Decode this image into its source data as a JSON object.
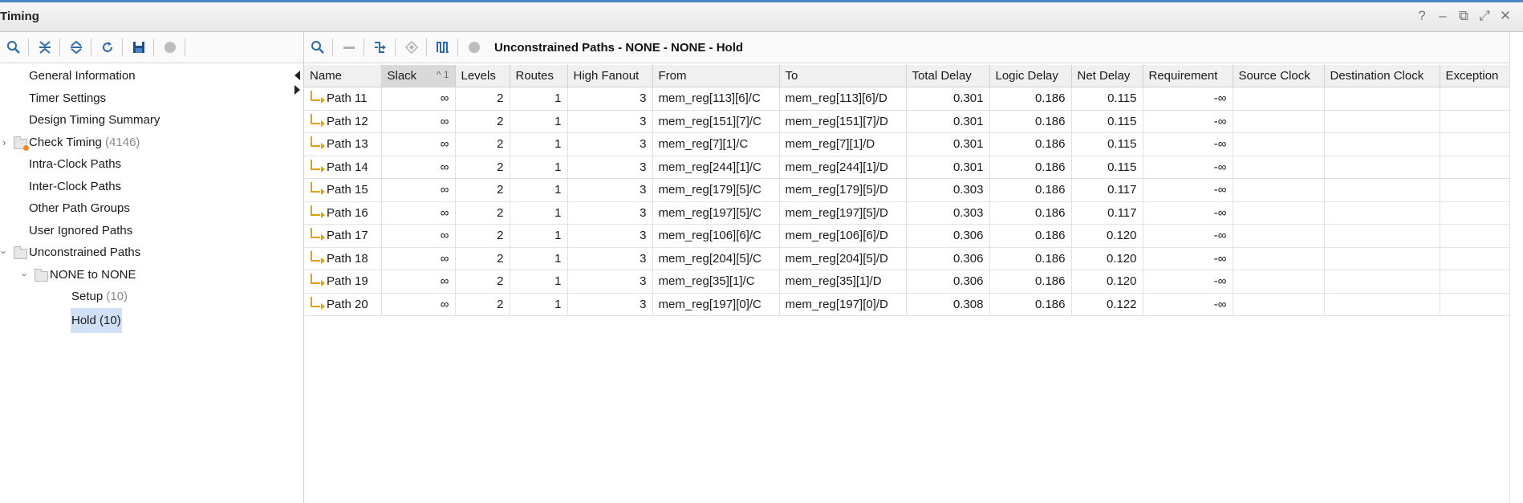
{
  "window": {
    "title": "Timing",
    "controls": [
      "?",
      "–",
      "⧉",
      "⤢",
      "✕"
    ]
  },
  "left_toolbar": {
    "icons": [
      "search-icon",
      "collapse-all-icon",
      "expand-all-icon",
      "refresh-icon",
      "save-icon",
      "stop-icon"
    ]
  },
  "tree": {
    "items": [
      {
        "label": "General Information",
        "count": "",
        "indent": 0
      },
      {
        "label": "Timer Settings",
        "count": "",
        "indent": 0
      },
      {
        "label": "Design Timing Summary",
        "count": "",
        "indent": 0
      },
      {
        "label": "Check Timing",
        "count": "(4146)",
        "indent": 0
      },
      {
        "label": "Intra-Clock Paths",
        "count": "",
        "indent": 0
      },
      {
        "label": "Inter-Clock Paths",
        "count": "",
        "indent": 0
      },
      {
        "label": "Other Path Groups",
        "count": "",
        "indent": 0
      },
      {
        "label": "User Ignored Paths",
        "count": "",
        "indent": 0
      },
      {
        "label": "Unconstrained Paths",
        "count": "",
        "indent": 0
      },
      {
        "label": "NONE to NONE",
        "count": "",
        "indent": 1
      },
      {
        "label": "Setup",
        "count": "(10)",
        "indent": 2
      },
      {
        "label": "Hold (10)",
        "count": "",
        "indent": 2
      }
    ]
  },
  "right_toolbar": {
    "icons": [
      "search-icon",
      "minus-icon",
      "schematic-icon",
      "diamond-icon",
      "waveform-icon",
      "stop-icon"
    ],
    "title": "Unconstrained Paths - NONE - NONE - Hold"
  },
  "table": {
    "columns": [
      "Name",
      "Slack",
      "Levels",
      "Routes",
      "High Fanout",
      "From",
      "To",
      "Total Delay",
      "Logic Delay",
      "Net Delay",
      "Requirement",
      "Source Clock",
      "Destination Clock",
      "Exception"
    ],
    "sort_mark": "^ 1",
    "rows": [
      [
        "Path 11",
        "∞",
        "2",
        "1",
        "3",
        "mem_reg[113][6]/C",
        "mem_reg[113][6]/D",
        "0.301",
        "0.186",
        "0.115",
        "-∞",
        "",
        "",
        ""
      ],
      [
        "Path 12",
        "∞",
        "2",
        "1",
        "3",
        "mem_reg[151][7]/C",
        "mem_reg[151][7]/D",
        "0.301",
        "0.186",
        "0.115",
        "-∞",
        "",
        "",
        ""
      ],
      [
        "Path 13",
        "∞",
        "2",
        "1",
        "3",
        "mem_reg[7][1]/C",
        "mem_reg[7][1]/D",
        "0.301",
        "0.186",
        "0.115",
        "-∞",
        "",
        "",
        ""
      ],
      [
        "Path 14",
        "∞",
        "2",
        "1",
        "3",
        "mem_reg[244][1]/C",
        "mem_reg[244][1]/D",
        "0.301",
        "0.186",
        "0.115",
        "-∞",
        "",
        "",
        ""
      ],
      [
        "Path 15",
        "∞",
        "2",
        "1",
        "3",
        "mem_reg[179][5]/C",
        "mem_reg[179][5]/D",
        "0.303",
        "0.186",
        "0.117",
        "-∞",
        "",
        "",
        ""
      ],
      [
        "Path 16",
        "∞",
        "2",
        "1",
        "3",
        "mem_reg[197][5]/C",
        "mem_reg[197][5]/D",
        "0.303",
        "0.186",
        "0.117",
        "-∞",
        "",
        "",
        ""
      ],
      [
        "Path 17",
        "∞",
        "2",
        "1",
        "3",
        "mem_reg[106][6]/C",
        "mem_reg[106][6]/D",
        "0.306",
        "0.186",
        "0.120",
        "-∞",
        "",
        "",
        ""
      ],
      [
        "Path 18",
        "∞",
        "2",
        "1",
        "3",
        "mem_reg[204][5]/C",
        "mem_reg[204][5]/D",
        "0.306",
        "0.186",
        "0.120",
        "-∞",
        "",
        "",
        ""
      ],
      [
        "Path 19",
        "∞",
        "2",
        "1",
        "3",
        "mem_reg[35][1]/C",
        "mem_reg[35][1]/D",
        "0.306",
        "0.186",
        "0.120",
        "-∞",
        "",
        "",
        ""
      ],
      [
        "Path 20",
        "∞",
        "2",
        "1",
        "3",
        "mem_reg[197][0]/C",
        "mem_reg[197][0]/D",
        "0.308",
        "0.186",
        "0.122",
        "-∞",
        "",
        "",
        ""
      ]
    ]
  },
  "colors": {
    "accent": "#4a86c8",
    "selection": "#cfe0f7",
    "icon": "#2e6aa6",
    "path_icon": "#e0a000",
    "warn": "#f08c1a"
  }
}
